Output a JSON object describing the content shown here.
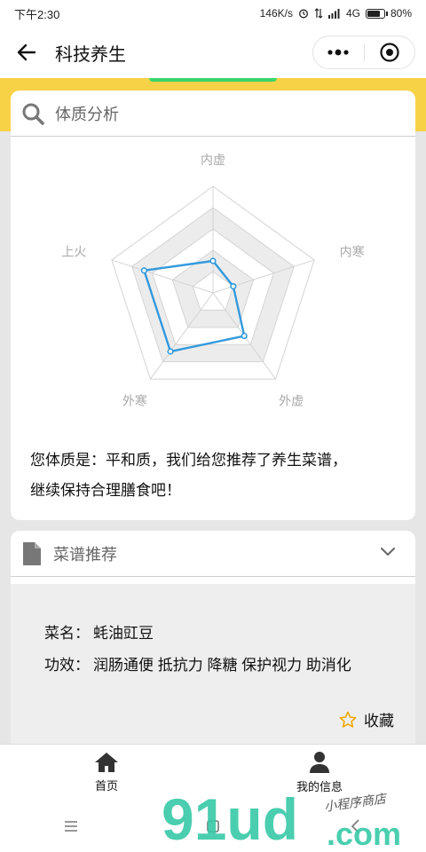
{
  "status_bar": {
    "time": "下午2:30",
    "net_speed": "146K/s",
    "network": "4G",
    "battery": "80%",
    "battery_level": 0.8
  },
  "nav": {
    "title": "科技养生",
    "back_icon": "arrow-left-icon",
    "more_icon": "more-dots-icon",
    "close_icon": "target-circle-icon"
  },
  "analysis": {
    "title": "体质分析",
    "icon": "search-icon",
    "radar": {
      "axes": [
        "内虚",
        "内寒",
        "外虚",
        "外寒",
        "上火"
      ],
      "values": [
        0.3,
        0.2,
        0.5,
        0.68,
        0.68
      ],
      "max": 1
    },
    "result_line1": "您体质是：平和质，我们给您推荐了养生菜谱，",
    "result_line2": "继续保持合理膳食吧！"
  },
  "recipe": {
    "title": "菜谱推荐",
    "icon": "document-icon",
    "expand_icon": "chevron-down-icon",
    "name_label": "菜名：",
    "name_value": "蚝油豇豆",
    "effect_label": "功效：",
    "effect_value": "润肠通便 抵抗力 降糖 保护视力 助消化",
    "favorite_label": "收藏",
    "favorite_icon": "star-outline-icon"
  },
  "tab_bar": {
    "home_label": "首页",
    "home_icon": "home-icon",
    "profile_label": "我的信息",
    "profile_icon": "user-icon"
  },
  "watermark": {
    "logo_text": "91ud.com",
    "sub_text": "小程序商店"
  },
  "colors": {
    "accent_yellow": "#f7d247",
    "radar_line": "#3399dd",
    "green_tab": "#3bd46a",
    "star": "#f0a800"
  }
}
